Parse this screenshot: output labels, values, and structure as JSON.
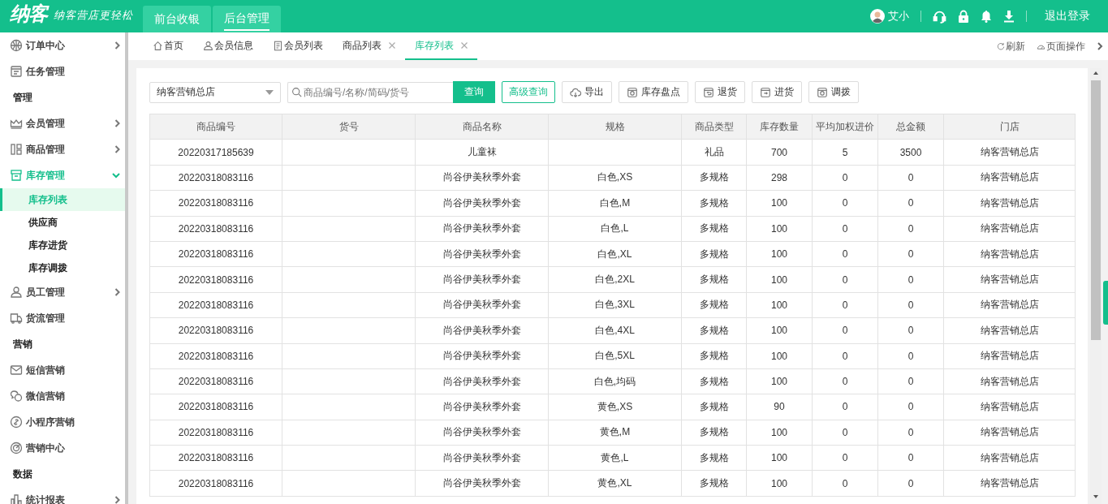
{
  "header": {
    "logo": "纳客",
    "slogan": "纳客营店更轻松",
    "modes": [
      {
        "label": "前台收银",
        "selected": false
      },
      {
        "label": "后台管理",
        "selected": true
      }
    ],
    "user": "艾小",
    "logout": "退出登录"
  },
  "sidebar": {
    "items": [
      {
        "kind": "item",
        "label": "订单中心",
        "expanded": false
      },
      {
        "kind": "item",
        "label": "任务管理"
      },
      {
        "kind": "section",
        "label": "管理"
      },
      {
        "kind": "item",
        "label": "会员管理",
        "expanded": false
      },
      {
        "kind": "item",
        "label": "商品管理",
        "expanded": false
      },
      {
        "kind": "item",
        "label": "库存管理",
        "expanded": true,
        "children": [
          {
            "label": "库存列表",
            "selected": true
          },
          {
            "label": "供应商",
            "selected": false
          },
          {
            "label": "库存进货",
            "selected": false
          },
          {
            "label": "库存调拨",
            "selected": false
          }
        ]
      },
      {
        "kind": "item",
        "label": "员工管理",
        "expanded": false
      },
      {
        "kind": "item",
        "label": "货流管理"
      },
      {
        "kind": "section",
        "label": "营销"
      },
      {
        "kind": "item",
        "label": "短信营销"
      },
      {
        "kind": "item",
        "label": "微信营销"
      },
      {
        "kind": "item",
        "label": "小程序营销"
      },
      {
        "kind": "item",
        "label": "营销中心"
      },
      {
        "kind": "section",
        "label": "数据"
      },
      {
        "kind": "item",
        "label": "统计报表",
        "expanded": false
      }
    ]
  },
  "page_tabs": [
    {
      "label": "首页",
      "closable": false,
      "selected": false
    },
    {
      "label": "会员信息",
      "closable": false,
      "selected": false
    },
    {
      "label": "会员列表",
      "closable": false,
      "selected": false
    },
    {
      "label": "商品列表",
      "closable": true,
      "selected": false
    },
    {
      "label": "库存列表",
      "closable": true,
      "selected": true
    }
  ],
  "tab_actions": [
    "刷新",
    "页面操作"
  ],
  "toolbar": {
    "store": "纳客营销总店",
    "search": {
      "placeholder": "商品编号/名称/简码/货号"
    },
    "query": "查询",
    "advanced": "高级查询",
    "buttons": [
      "导出",
      "库存盘点",
      "退货",
      "进货",
      "调拨"
    ]
  },
  "table": {
    "columns": [
      "商品编号",
      "货号",
      "商品名称",
      "规格",
      "商品类型",
      "库存数量",
      "平均加权进价",
      "总金额",
      "门店"
    ],
    "rows": [
      [
        "20220317185639",
        "",
        "儿童袜",
        "",
        "礼品",
        "700",
        "5",
        "3500",
        "纳客营销总店"
      ],
      [
        "20220318083116",
        "",
        "尚谷伊美秋季外套",
        "白色,XS",
        "多规格",
        "298",
        "0",
        "0",
        "纳客营销总店"
      ],
      [
        "20220318083116",
        "",
        "尚谷伊美秋季外套",
        "白色,M",
        "多规格",
        "100",
        "0",
        "0",
        "纳客营销总店"
      ],
      [
        "20220318083116",
        "",
        "尚谷伊美秋季外套",
        "白色,L",
        "多规格",
        "100",
        "0",
        "0",
        "纳客营销总店"
      ],
      [
        "20220318083116",
        "",
        "尚谷伊美秋季外套",
        "白色,XL",
        "多规格",
        "100",
        "0",
        "0",
        "纳客营销总店"
      ],
      [
        "20220318083116",
        "",
        "尚谷伊美秋季外套",
        "白色,2XL",
        "多规格",
        "100",
        "0",
        "0",
        "纳客营销总店"
      ],
      [
        "20220318083116",
        "",
        "尚谷伊美秋季外套",
        "白色,3XL",
        "多规格",
        "100",
        "0",
        "0",
        "纳客营销总店"
      ],
      [
        "20220318083116",
        "",
        "尚谷伊美秋季外套",
        "白色,4XL",
        "多规格",
        "100",
        "0",
        "0",
        "纳客营销总店"
      ],
      [
        "20220318083116",
        "",
        "尚谷伊美秋季外套",
        "白色,5XL",
        "多规格",
        "100",
        "0",
        "0",
        "纳客营销总店"
      ],
      [
        "20220318083116",
        "",
        "尚谷伊美秋季外套",
        "白色,均码",
        "多规格",
        "100",
        "0",
        "0",
        "纳客营销总店"
      ],
      [
        "20220318083116",
        "",
        "尚谷伊美秋季外套",
        "黄色,XS",
        "多规格",
        "90",
        "0",
        "0",
        "纳客营销总店"
      ],
      [
        "20220318083116",
        "",
        "尚谷伊美秋季外套",
        "黄色,M",
        "多规格",
        "100",
        "0",
        "0",
        "纳客营销总店"
      ],
      [
        "20220318083116",
        "",
        "尚谷伊美秋季外套",
        "黄色,L",
        "多规格",
        "100",
        "0",
        "0",
        "纳客营销总店"
      ],
      [
        "20220318083116",
        "",
        "尚谷伊美秋季外套",
        "黄色,XL",
        "多规格",
        "100",
        "0",
        "0",
        "纳客营销总店"
      ]
    ]
  }
}
